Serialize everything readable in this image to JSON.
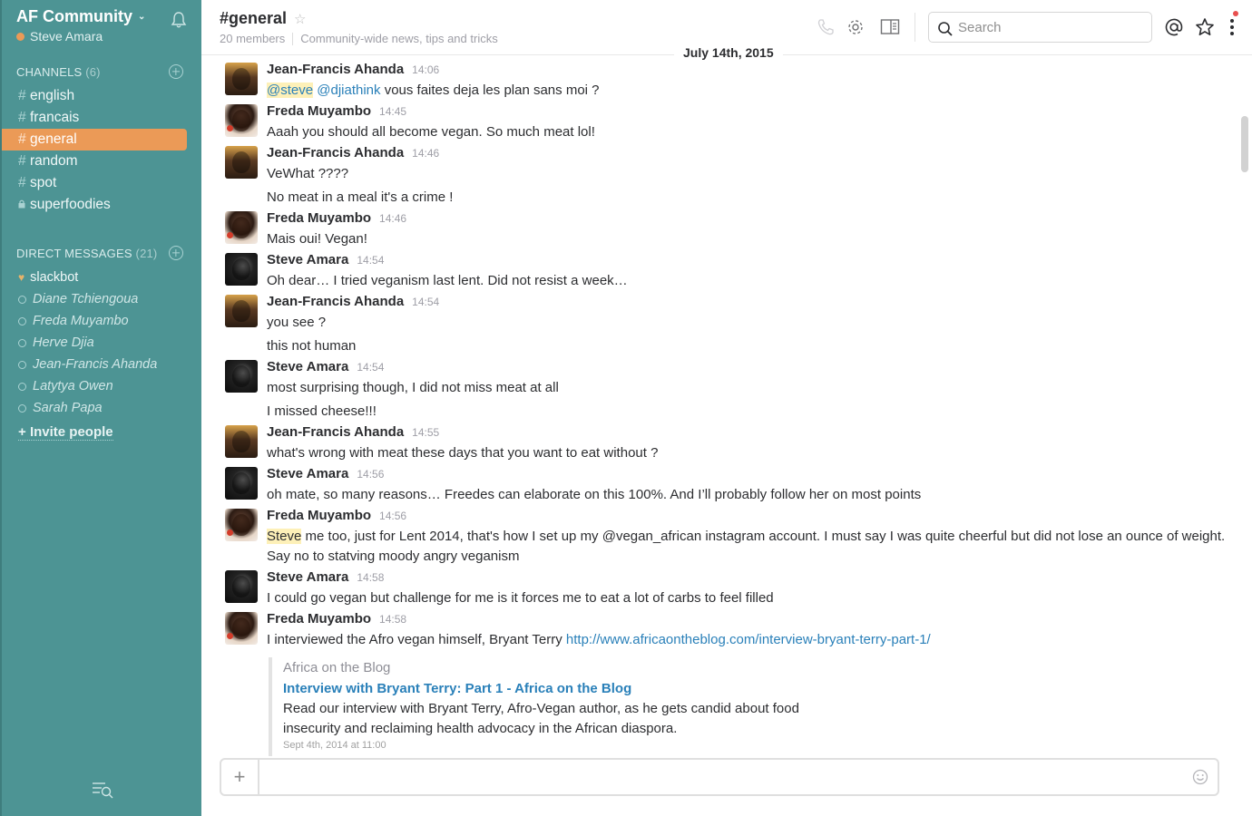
{
  "team": {
    "name": "AF Community",
    "user": "Steve Amara"
  },
  "channels_section": {
    "label": "CHANNELS",
    "count": "(6)"
  },
  "channels": [
    {
      "name": "english",
      "prefix": "#",
      "active": false
    },
    {
      "name": "francais",
      "prefix": "#",
      "active": false
    },
    {
      "name": "general",
      "prefix": "#",
      "active": true
    },
    {
      "name": "random",
      "prefix": "#",
      "active": false
    },
    {
      "name": "spot",
      "prefix": "#",
      "active": false
    },
    {
      "name": "superfoodies",
      "prefix": "lock",
      "active": false
    }
  ],
  "dm_section": {
    "label": "DIRECT MESSAGES",
    "count": "(21)"
  },
  "dms": [
    {
      "name": "slackbot",
      "bot": true
    },
    {
      "name": "Diane Tchiengoua",
      "bot": false
    },
    {
      "name": "Freda Muyambo",
      "bot": false
    },
    {
      "name": "Herve Djia",
      "bot": false
    },
    {
      "name": "Jean-Francis Ahanda",
      "bot": false
    },
    {
      "name": "Latytya Owen",
      "bot": false
    },
    {
      "name": "Sarah Papa",
      "bot": false
    }
  ],
  "invite_label": "Invite people",
  "header": {
    "channel": "#general",
    "members": "20 members",
    "purpose": "Community-wide news, tips and tricks",
    "search_placeholder": "Search"
  },
  "date_divider": "July 14th, 2015",
  "colors": {
    "sidebar": "#4d9494",
    "active_channel": "#eb9a57",
    "link": "#2a80b9",
    "mention_highlight": "#fdf0b8"
  },
  "messages": [
    {
      "author": "Jean-Francis Ahanda",
      "time": "14:06",
      "lines": [
        [
          {
            "t": "@steve",
            "k": "mention hl"
          },
          {
            "t": " ",
            "k": ""
          },
          {
            "t": "@djiathink",
            "k": "mention"
          },
          {
            "t": " vous faites deja les plan sans moi ?",
            "k": ""
          }
        ]
      ]
    },
    {
      "author": "Freda Muyambo",
      "time": "14:45",
      "lines": [
        [
          {
            "t": "Aaah you should all become vegan. So much meat lol!",
            "k": ""
          }
        ]
      ]
    },
    {
      "author": "Jean-Francis Ahanda",
      "time": "14:46",
      "lines": [
        [
          {
            "t": "VeWhat ????",
            "k": ""
          }
        ],
        [
          {
            "t": "No meat in a meal it's a crime !",
            "k": ""
          }
        ]
      ]
    },
    {
      "author": "Freda Muyambo",
      "time": "14:46",
      "lines": [
        [
          {
            "t": "Mais oui! Vegan!",
            "k": ""
          }
        ]
      ]
    },
    {
      "author": "Steve Amara",
      "time": "14:54",
      "lines": [
        [
          {
            "t": "Oh dear… I tried veganism last lent. Did not resist a week…",
            "k": ""
          }
        ]
      ]
    },
    {
      "author": "Jean-Francis Ahanda",
      "time": "14:54",
      "lines": [
        [
          {
            "t": "you see ?",
            "k": ""
          }
        ],
        [
          {
            "t": "this not human",
            "k": ""
          }
        ]
      ]
    },
    {
      "author": "Steve Amara",
      "time": "14:54",
      "lines": [
        [
          {
            "t": "most surprising though,  I did not miss meat at all",
            "k": ""
          }
        ],
        [
          {
            "t": "I missed cheese!!!",
            "k": ""
          }
        ]
      ]
    },
    {
      "author": "Jean-Francis Ahanda",
      "time": "14:55",
      "lines": [
        [
          {
            "t": "what's wrong with meat these days that you want to eat without ?",
            "k": ""
          }
        ]
      ]
    },
    {
      "author": "Steve Amara",
      "time": "14:56",
      "lines": [
        [
          {
            "t": "oh mate, so many reasons… Freedes can elaborate on this 100%. And I’ll probably follow her on most points",
            "k": ""
          }
        ]
      ]
    },
    {
      "author": "Freda Muyambo",
      "time": "14:56",
      "lines": [
        [
          {
            "t": "Steve",
            "k": "hl"
          },
          {
            "t": " me too, just for Lent 2014, that's how I set up my @vegan_african instagram account. I must say I was quite cheerful but did not lose an ounce of weight.",
            "k": ""
          }
        ],
        [
          {
            "t": "Say no to statving moody angry veganism",
            "k": "nogap"
          }
        ]
      ]
    },
    {
      "author": "Steve Amara",
      "time": "14:58",
      "lines": [
        [
          {
            "t": "I could go vegan but challenge for me is it forces me to eat a lot of carbs to feel filled",
            "k": ""
          }
        ]
      ]
    },
    {
      "author": "Freda Muyambo",
      "time": "14:58",
      "lines": [
        [
          {
            "t": "I interviewed the Afro vegan himself, Bryant Terry ",
            "k": ""
          },
          {
            "t": "http://www.africaontheblog.com/interview-bryant-terry-part-1/",
            "k": "link"
          }
        ]
      ],
      "attachment": {
        "site": "Africa on the Blog",
        "title": "Interview with Bryant Terry: Part 1 - Africa on the Blog",
        "desc": "Read our interview with Bryant Terry, Afro-Vegan author, as he gets candid about food insecurity and reclaiming health advocacy in the African diaspora.",
        "footer": "Sept 4th, 2014 at 11:00"
      }
    }
  ]
}
